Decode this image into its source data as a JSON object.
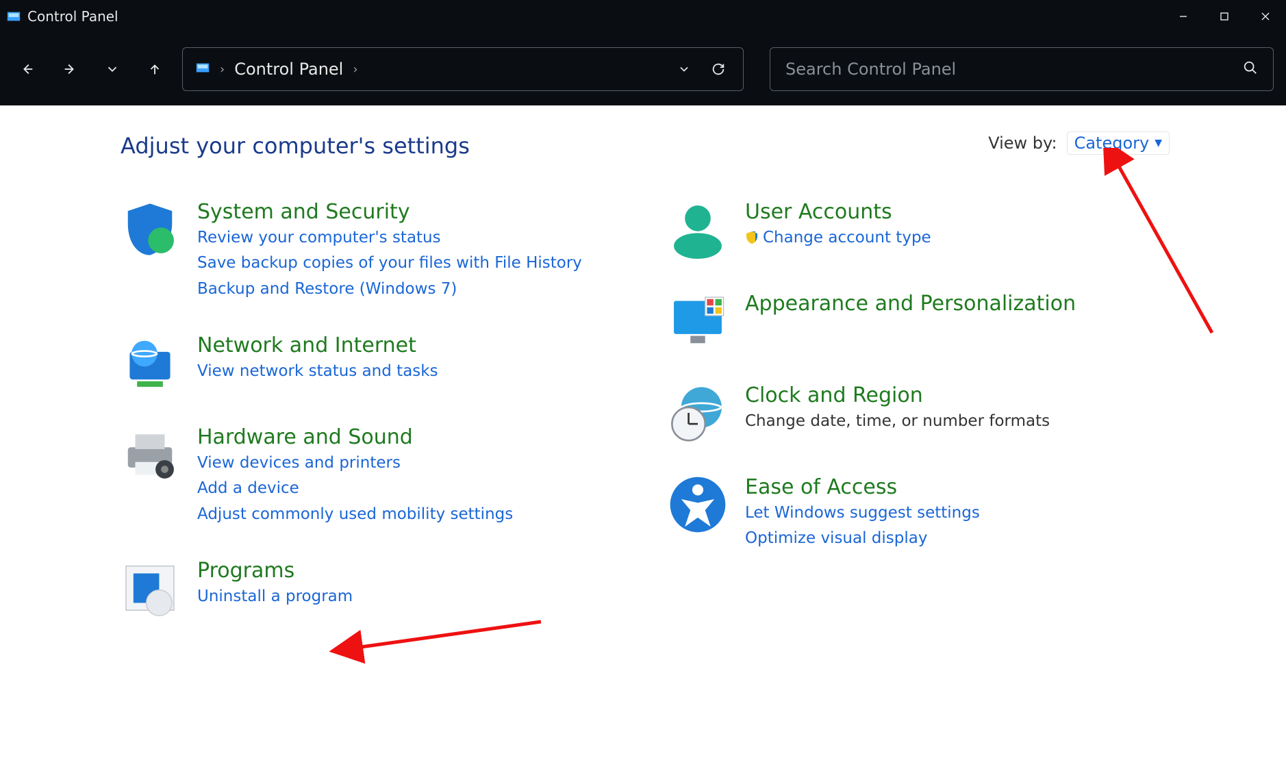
{
  "window": {
    "title": "Control Panel"
  },
  "nav": {
    "breadcrumb": "Control Panel",
    "search_placeholder": "Search Control Panel"
  },
  "main": {
    "heading": "Adjust your computer's settings",
    "viewby_label": "View by:",
    "viewby_value": "Category"
  },
  "categories_left": [
    {
      "title": "System and Security",
      "links": [
        "Review your computer's status",
        "Save backup copies of your files with File History",
        "Backup and Restore (Windows 7)"
      ]
    },
    {
      "title": "Network and Internet",
      "links": [
        "View network status and tasks"
      ]
    },
    {
      "title": "Hardware and Sound",
      "links": [
        "View devices and printers",
        "Add a device",
        "Adjust commonly used mobility settings"
      ]
    },
    {
      "title": "Programs",
      "links": [
        "Uninstall a program"
      ]
    }
  ],
  "categories_right": [
    {
      "title": "User Accounts",
      "links": [
        "Change account type"
      ],
      "shield": true
    },
    {
      "title": "Appearance and Personalization",
      "links": []
    },
    {
      "title": "Clock and Region",
      "links": [],
      "plain": [
        "Change date, time, or number formats"
      ]
    },
    {
      "title": "Ease of Access",
      "links": [
        "Let Windows suggest settings",
        "Optimize visual display"
      ]
    }
  ]
}
